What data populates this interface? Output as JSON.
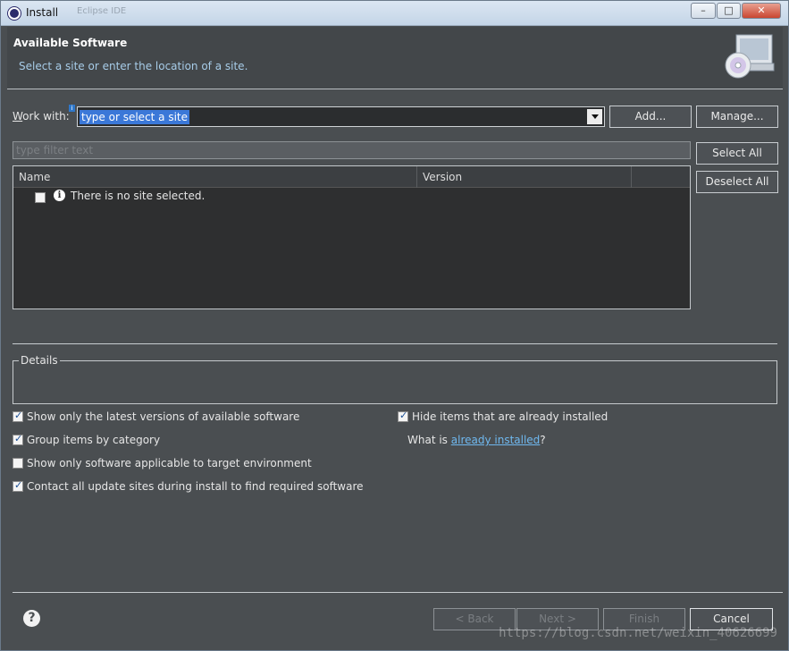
{
  "window": {
    "title": "Install",
    "ghost_title": "Eclipse IDE"
  },
  "header": {
    "heading": "Available Software",
    "subtitle": "Select a site or enter the location of a site."
  },
  "work_with": {
    "label_prefix": "W",
    "label_rest": "ork with:",
    "value": "type or select a site",
    "info_mark": "i"
  },
  "buttons": {
    "add": "Add...",
    "manage": "Manage...",
    "select_all": "Select All",
    "deselect_all": "Deselect All",
    "back": "< Back",
    "next": "Next >",
    "finish": "Finish",
    "cancel": "Cancel"
  },
  "filter": {
    "placeholder": "type filter text"
  },
  "table": {
    "columns": [
      "Name",
      "Version"
    ],
    "rows": [
      {
        "name": "There is no site selected.",
        "version": "",
        "checked": false
      }
    ]
  },
  "details": {
    "label": "Details"
  },
  "options": {
    "latest_versions": {
      "label": "Show only the latest versions of available software",
      "checked": true
    },
    "group_by_category": {
      "label": "Group items by category",
      "checked": true
    },
    "target_env": {
      "label": "Show only software applicable to target environment",
      "checked": false
    },
    "contact_sites": {
      "label": "Contact all update sites during install to find required software",
      "checked": true
    },
    "hide_installed": {
      "label": "Hide items that are already installed",
      "checked": true
    },
    "what_is_prefix": "What is ",
    "what_is_link": "already installed",
    "what_is_suffix": "?"
  },
  "help_glyph": "?",
  "watermark": "https://blog.csdn.net/weixin_40626699"
}
